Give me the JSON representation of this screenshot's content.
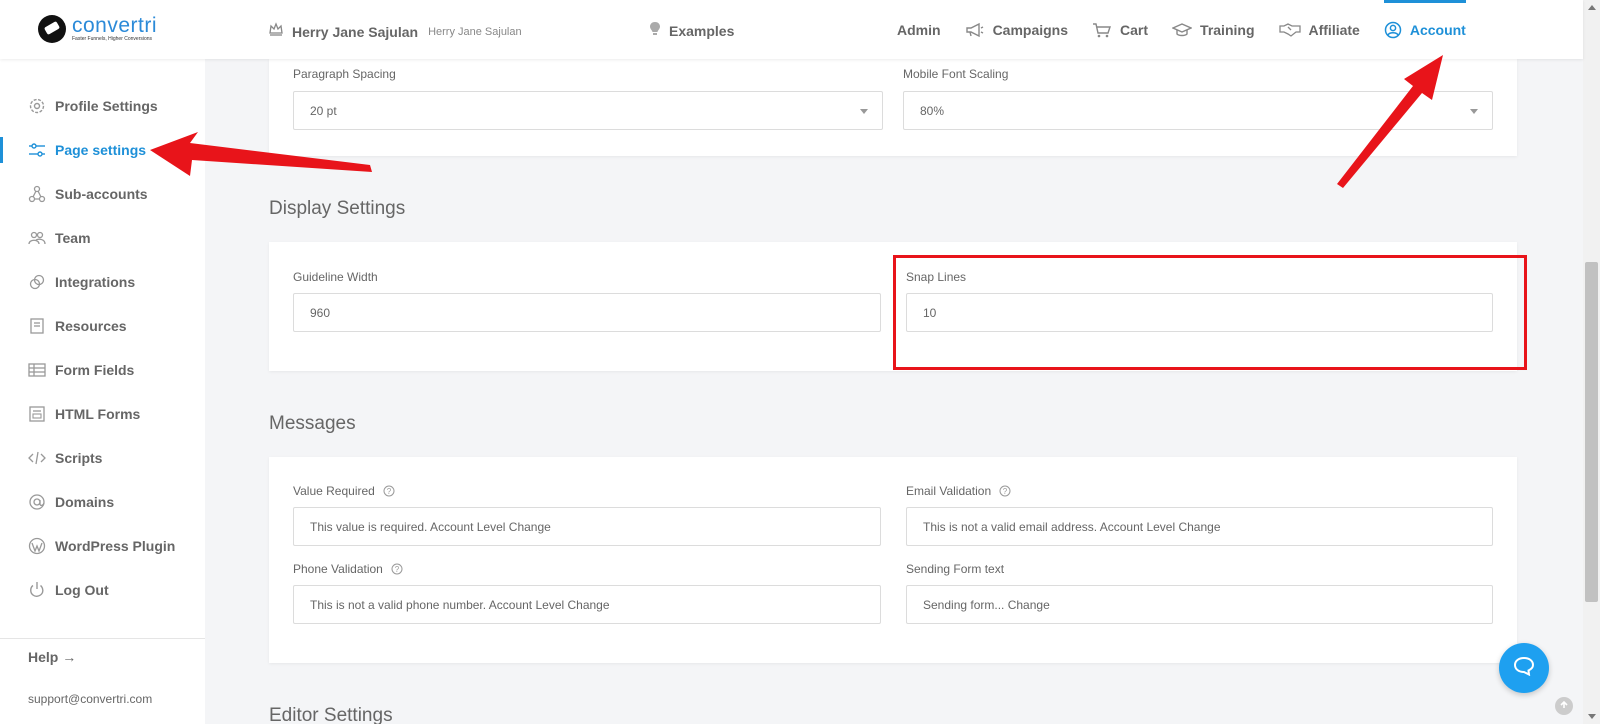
{
  "header": {
    "logo": {
      "name": "convertri",
      "tagline": "Faster Funnels, Higher Conversions"
    },
    "user_name": "Herry Jane Sajulan",
    "user_sub": "Herry Jane Sajulan",
    "examples_label": "Examples",
    "nav": [
      {
        "label": "Admin",
        "icon": ""
      },
      {
        "label": "Campaigns",
        "icon": "megaphone-icon"
      },
      {
        "label": "Cart",
        "icon": "cart-icon"
      },
      {
        "label": "Training",
        "icon": "graduation-cap-icon"
      },
      {
        "label": "Affiliate",
        "icon": "handshake-icon"
      },
      {
        "label": "Account",
        "icon": "user-circle-icon",
        "active": true
      }
    ]
  },
  "sidebar": {
    "items": [
      {
        "label": "Profile Settings",
        "icon": "gear-icon"
      },
      {
        "label": "Page settings",
        "icon": "sliders-icon",
        "active": true
      },
      {
        "label": "Sub-accounts",
        "icon": "network-icon"
      },
      {
        "label": "Team",
        "icon": "team-icon"
      },
      {
        "label": "Integrations",
        "icon": "link-icon"
      },
      {
        "label": "Resources",
        "icon": "book-icon"
      },
      {
        "label": "Form Fields",
        "icon": "table-icon"
      },
      {
        "label": "HTML Forms",
        "icon": "form-icon"
      },
      {
        "label": "Scripts",
        "icon": "code-icon"
      },
      {
        "label": "Domains",
        "icon": "at-icon"
      },
      {
        "label": "WordPress Plugin",
        "icon": "wordpress-icon"
      },
      {
        "label": "Log Out",
        "icon": "power-icon"
      }
    ],
    "help_label": "Help →",
    "support_email": "support@convertri.com"
  },
  "typography": {
    "paragraph_spacing_label": "Paragraph Spacing",
    "paragraph_spacing_value": "20 pt",
    "mobile_font_scaling_label": "Mobile Font Scaling",
    "mobile_font_scaling_value": "80%"
  },
  "display_settings": {
    "title": "Display Settings",
    "guideline_width_label": "Guideline Width",
    "guideline_width_value": "960",
    "snap_lines_label": "Snap Lines",
    "snap_lines_value": "10"
  },
  "messages": {
    "title": "Messages",
    "value_required_label": "Value Required",
    "value_required_value": "This value is required. Account Level Change",
    "email_validation_label": "Email Validation",
    "email_validation_value": "This is not a valid email address. Account Level Change",
    "phone_validation_label": "Phone Validation",
    "phone_validation_value": "This is not a valid phone number. Account Level Change",
    "sending_form_label": "Sending Form text",
    "sending_form_value": "Sending form... Change"
  },
  "editor_settings": {
    "title": "Editor Settings"
  },
  "colors": {
    "accent": "#1e90d8",
    "annotation": "#e8141a",
    "fab": "#1ea0f0"
  }
}
